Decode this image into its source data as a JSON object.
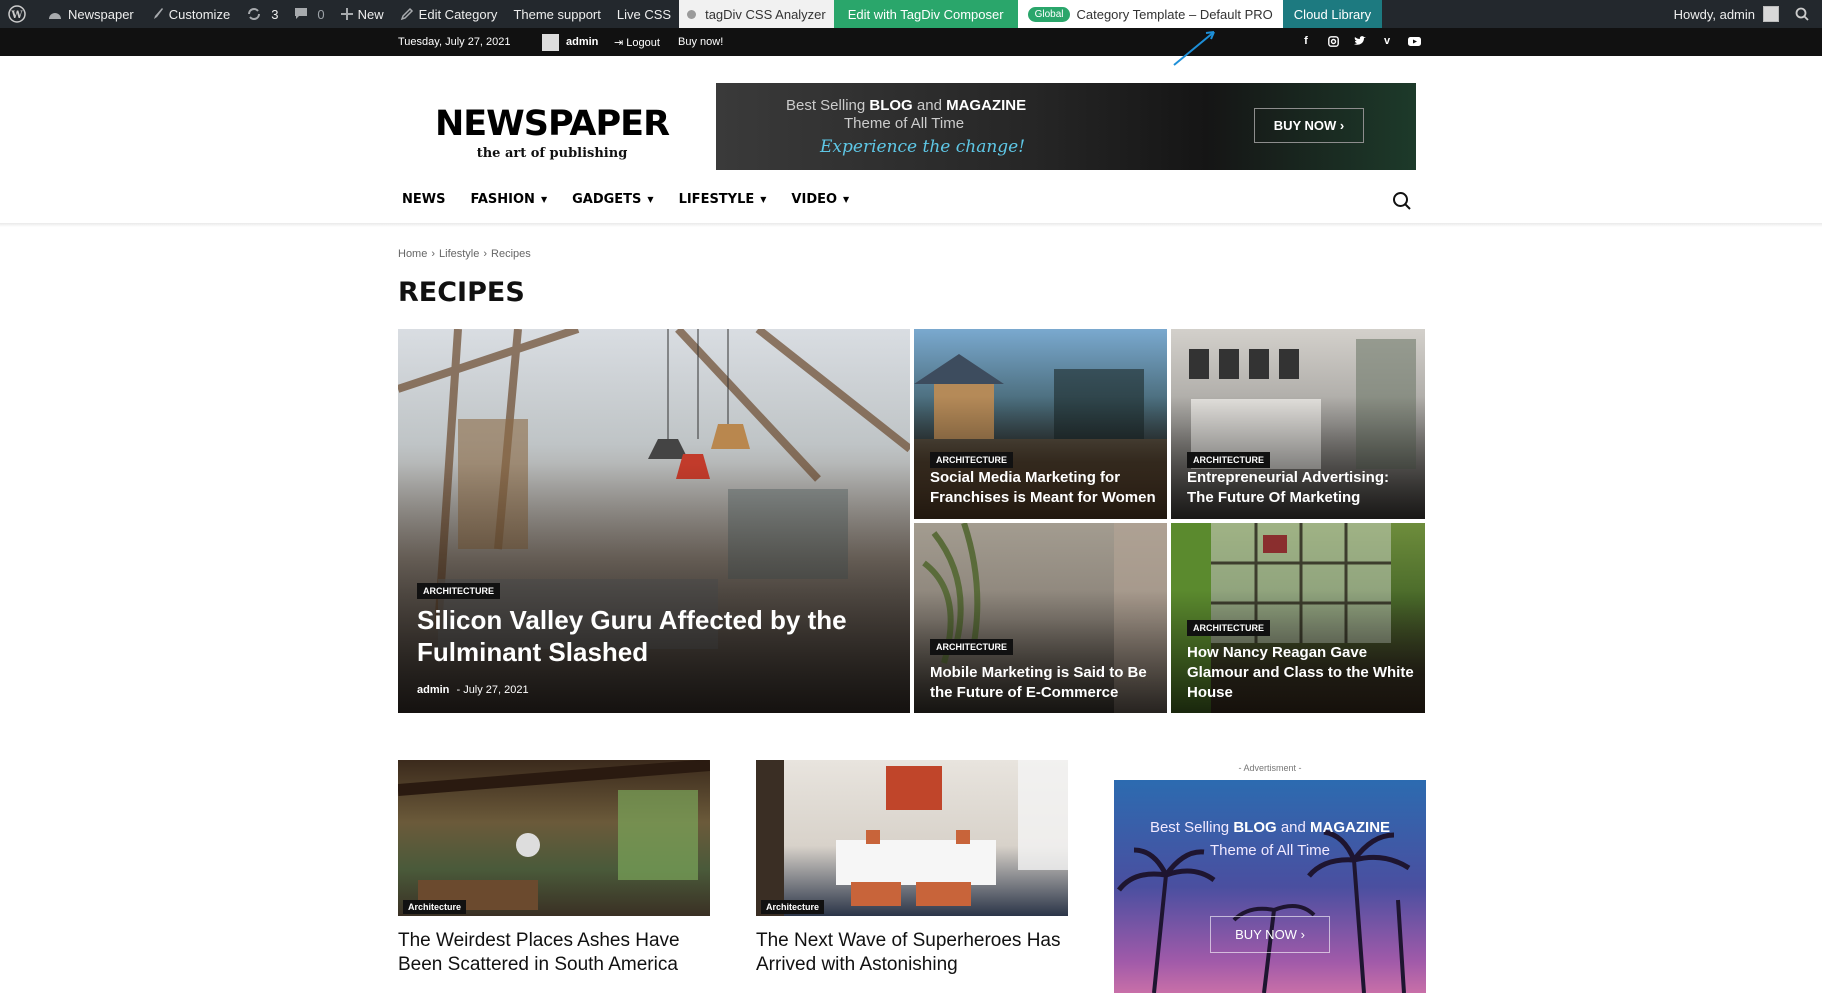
{
  "adminbar": {
    "site": "Newspaper",
    "customize": "Customize",
    "updates": "3",
    "comments": "0",
    "new": "New",
    "edit_category": "Edit Category",
    "theme_support": "Theme support",
    "live_css": "Live CSS",
    "css_analyzer": "tagDiv CSS Analyzer",
    "composer": "Edit with TagDiv Composer",
    "global_pill": "Global",
    "template": "Category Template – Default PRO",
    "cloud": "Cloud Library",
    "howdy": "Howdy, admin"
  },
  "topbar": {
    "date": "Tuesday, July 27, 2021",
    "user": "admin",
    "logout": "Logout",
    "buy": "Buy now!"
  },
  "header": {
    "logo": "NEWSPAPER",
    "tagline": "the art of publishing",
    "banner_line1_pre": "Best Selling ",
    "banner_line1_b1": "BLOG",
    "banner_line1_mid": " and ",
    "banner_line1_b2": "MAGAZINE",
    "banner_line2": "Theme of All Time",
    "banner_line3": "Experience the change!",
    "banner_button": "BUY NOW ›"
  },
  "nav": {
    "items": [
      "NEWS",
      "FASHION",
      "GADGETS",
      "LIFESTYLE",
      "VIDEO"
    ]
  },
  "breadcrumb": {
    "home": "Home",
    "sep": "›",
    "parent": "Lifestyle",
    "current": "Recipes"
  },
  "page_title": "RECIPES",
  "featured": {
    "main": {
      "category": "ARCHITECTURE",
      "title": "Silicon Valley Guru Affected by the Fulminant Slashed",
      "author": "admin",
      "date": "- July 27, 2021"
    },
    "small": [
      {
        "category": "ARCHITECTURE",
        "title": "Social Media Marketing for Franchises is Meant for Women"
      },
      {
        "category": "ARCHITECTURE",
        "title": "Entrepreneurial Advertising: The Future Of Marketing"
      },
      {
        "category": "ARCHITECTURE",
        "title": "Mobile Marketing is Said to Be the Future of E-Commerce"
      },
      {
        "category": "ARCHITECTURE",
        "title": "How Nancy Reagan Gave Glamour and Class to the White House"
      }
    ]
  },
  "cards": [
    {
      "label": "Architecture",
      "title": "The Weirdest Places Ashes Have Been Scattered in South America"
    },
    {
      "label": "Architecture",
      "title": "The Next Wave of Superheroes Has Arrived with Astonishing"
    }
  ],
  "sidebar_ad": {
    "label": "- Advertisment -",
    "line1_pre": "Best Selling ",
    "line1_b1": "BLOG",
    "line1_mid": " and ",
    "line1_b2": "MAGAZINE",
    "line2": "Theme of All Time",
    "button": "BUY NOW ›"
  },
  "colors": {
    "admin_bar": "#23282d",
    "composer_green": "#2aa66b",
    "cloud_teal": "#1d7a80",
    "topbar": "#111111"
  }
}
